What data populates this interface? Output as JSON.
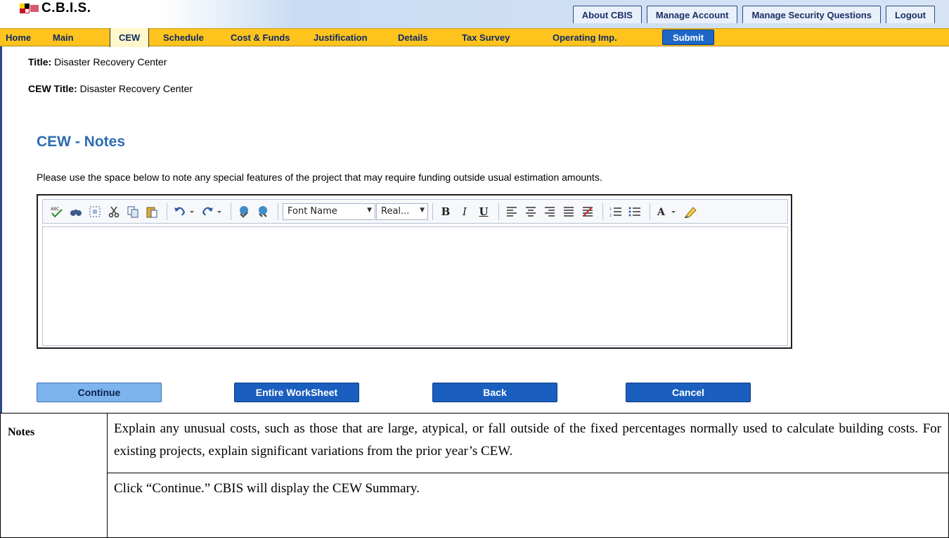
{
  "app": {
    "logo_text": "C.B.I.S.",
    "flag_colors": [
      "#c8102e",
      "#ffd200",
      "#000000",
      "#ffffff"
    ]
  },
  "util_tabs": [
    "About CBIS",
    "Manage Account",
    "Manage Security Questions",
    "Logout"
  ],
  "nav": {
    "items": [
      "Home",
      "Main",
      "CEW",
      "Schedule",
      "Cost & Funds",
      "Justification",
      "Details",
      "Tax Survey",
      "Operating Imp."
    ],
    "active": "CEW",
    "submit_label": "Submit"
  },
  "project": {
    "title_label": "Title:",
    "title_value": "Disaster Recovery Center",
    "cew_title_label": "CEW Title:",
    "cew_title_value": "Disaster Recovery Center"
  },
  "section": {
    "heading": "CEW - Notes",
    "instructions": "Please use the space below to note any special features of the project that may require funding outside usual estimation amounts."
  },
  "editor": {
    "font_name_value": "Font Name",
    "font_size_value": "Real...",
    "toolbar_icons": [
      "spellcheck-icon",
      "find-icon",
      "select-all-icon",
      "cut-icon",
      "copy-icon",
      "paste-icon",
      "undo-icon",
      "redo-icon",
      "insert-link-icon",
      "remove-link-icon",
      "bold-icon",
      "italic-icon",
      "underline-icon",
      "align-left-icon",
      "align-center-icon",
      "align-right-icon",
      "justify-icon",
      "clear-format-icon",
      "numbered-list-icon",
      "bullet-list-icon",
      "font-color-icon",
      "highlight-icon"
    ],
    "content": ""
  },
  "buttons": {
    "continue": "Continue",
    "entire_worksheet": "Entire WorkSheet",
    "back": "Back",
    "cancel": "Cancel"
  },
  "doc": {
    "term": "Notes",
    "paragraph1": "Explain any unusual costs, such as those that are large, atypical, or fall outside of the fixed percentages normally used to calculate building costs. For existing projects, explain significant  variations from the prior year’s CEW.",
    "paragraph2": "Click “Continue.” CBIS will display the CEW Summary."
  }
}
